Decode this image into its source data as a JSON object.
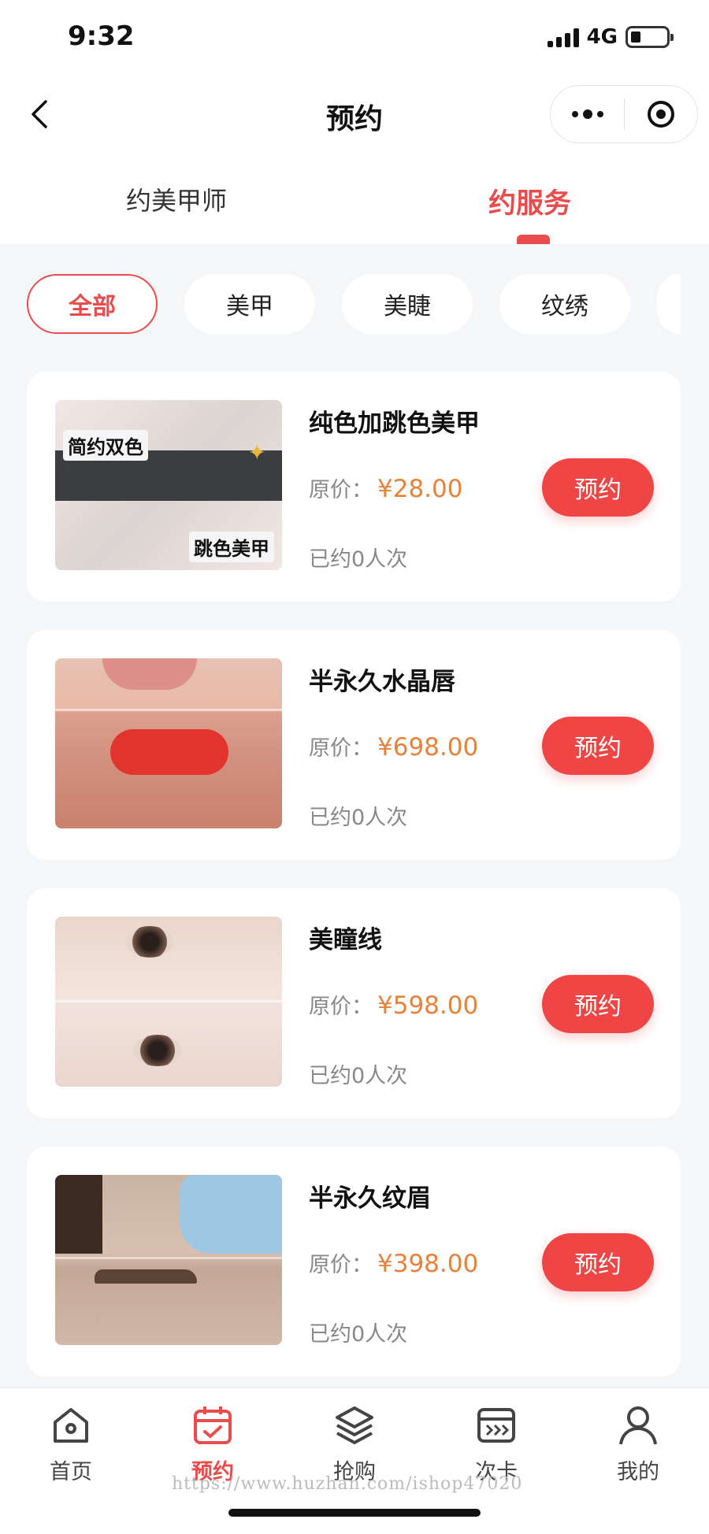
{
  "status_bar": {
    "time": "9:32",
    "network": "4G"
  },
  "nav": {
    "title": "预约"
  },
  "tabs": [
    {
      "label": "约美甲师",
      "active": false
    },
    {
      "label": "约服务",
      "active": true
    }
  ],
  "filters": [
    {
      "label": "全部",
      "active": true
    },
    {
      "label": "美甲",
      "active": false
    },
    {
      "label": "美睫",
      "active": false
    },
    {
      "label": "纹绣",
      "active": false
    }
  ],
  "thumb_text": {
    "nail_tag_1": "简约双色",
    "nail_tag_2": "跳色美甲"
  },
  "services": [
    {
      "name": "纯色加跳色美甲",
      "price_label": "原价：",
      "price": "¥28.00",
      "booked": "已约0人次",
      "button": "预约"
    },
    {
      "name": "半永久水晶唇",
      "price_label": "原价：",
      "price": "¥698.00",
      "booked": "已约0人次",
      "button": "预约"
    },
    {
      "name": "美瞳线",
      "price_label": "原价：",
      "price": "¥598.00",
      "booked": "已约0人次",
      "button": "预约"
    },
    {
      "name": "半永久纹眉",
      "price_label": "原价：",
      "price": "¥398.00",
      "booked": "已约0人次",
      "button": "预约"
    }
  ],
  "tab_bar": [
    {
      "label": "首页",
      "icon": "home-icon",
      "active": false
    },
    {
      "label": "预约",
      "icon": "calendar-icon",
      "active": true
    },
    {
      "label": "抢购",
      "icon": "layers-icon",
      "active": false
    },
    {
      "label": "次卡",
      "icon": "card-icon",
      "active": false
    },
    {
      "label": "我的",
      "icon": "user-icon",
      "active": false
    }
  ],
  "watermark": "https://www.huzhan.com/ishop47020",
  "colors": {
    "accent": "#e84c4c",
    "price": "#e8813a",
    "button": "#ef4545"
  }
}
